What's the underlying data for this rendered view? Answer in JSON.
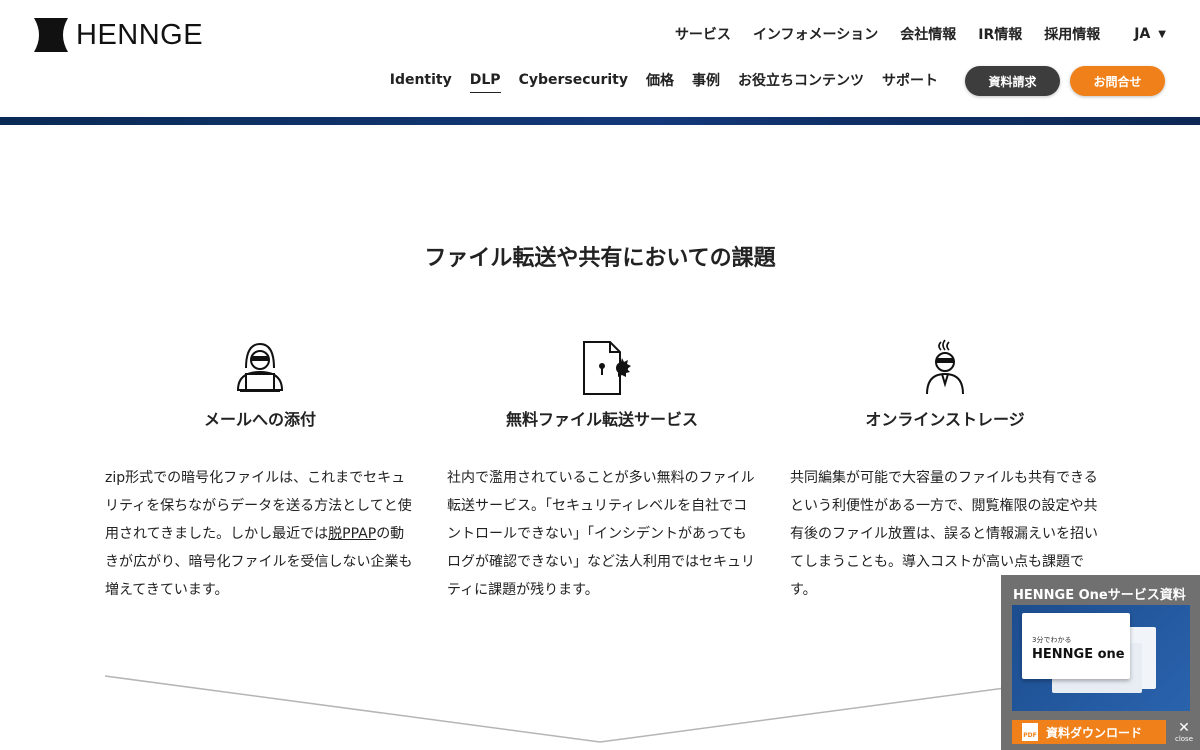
{
  "header": {
    "logo_text": "HENNGE",
    "top_nav": [
      "サービス",
      "インフォメーション",
      "会社情報",
      "IR情報",
      "採用情報"
    ],
    "lang": "JA",
    "main_nav": [
      "Identity",
      "DLP",
      "Cybersecurity",
      "価格",
      "事例",
      "お役立ちコンテンツ",
      "サポート"
    ],
    "active_nav": "DLP",
    "btn_docs": "資料請求",
    "btn_contact": "お問合せ"
  },
  "section": {
    "title": "ファイル転送や共有においての課題",
    "columns": [
      {
        "title": "メールへの添付",
        "text_before": "zip形式での暗号化ファイルは、これまでセキュリティを保ちながらデータを送る方法としてと使用されてきました。しかし最近では",
        "link": "脱PPAP",
        "text_after": "の動きが広がり、暗号化ファイルを受信しない企業も増えてきています。"
      },
      {
        "title": "無料ファイル転送サービス",
        "text": "社内で濫用されていることが多い無料のファイル転送サービス。「セキュリティレベルを自社でコントロールできない」「インシデントがあってもログが確認できない」など法人利用ではセキュリティに課題が残ります。"
      },
      {
        "title": "オンラインストレージ",
        "text": "共同編集が可能で大容量のファイルも共有できるという利便性がある一方で、閲覧権限の設定や共有後のファイル放置は、誤ると情報漏えいを招いてしまうことも。導入コストが高い点も課題です。"
      }
    ]
  },
  "banner": {
    "title": "HENNGE Oneサービス資料",
    "doc_small": "3分でわかる",
    "doc_brand": "HENNGE one",
    "download_label": "資料ダウンロード",
    "pdf_label": "PDF",
    "close_label": "close"
  },
  "colors": {
    "accent_orange": "#f08019",
    "dark_button": "#3d3d3d",
    "header_band": "#13397a",
    "banner_bg": "#707070"
  }
}
